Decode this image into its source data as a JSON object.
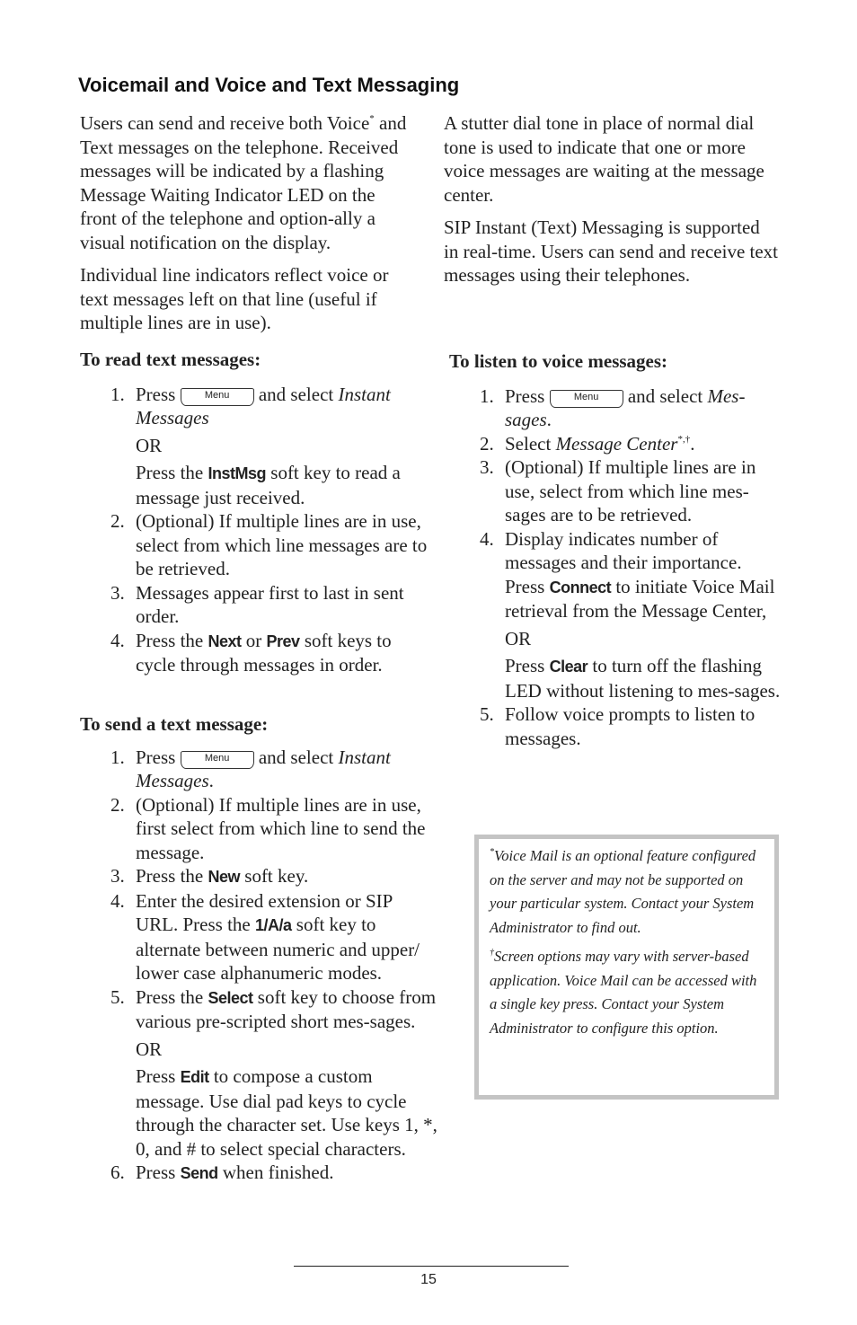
{
  "title": "Voicemail and Voice and Text Messaging",
  "intro_left": {
    "p1_a": "Users can send and receive both Voice",
    "p1_sup": "*",
    "p1_b": "and Text messages on the telephone. Received messages will be indicated by a flashing Message Waiting Indicator LED on the front of the telephone and option-ally a visual notification on the display.",
    "p2": "Individual line indicators reflect voice or text messages left on that line (useful if multiple lines are in use)."
  },
  "intro_right": {
    "p1": "A stutter dial tone in place of normal dial tone is used to indicate that one or more voice messages are waiting at the message center.",
    "p2": "SIP Instant (Text) Messaging is supported in real-time.  Users can send and receive text messages using their telephones."
  },
  "menu_key_label": "Menu",
  "read": {
    "heading": "To read text messages:",
    "s1_num": "1.",
    "s1_a": "Press",
    "s1_b": "and select",
    "s1_c": "Instant Messages",
    "or": "OR",
    "s1_d": "Press the",
    "s1_key": "InstMsg",
    "s1_e": "soft key to read a message just received.",
    "s2_num": "2.",
    "s2": "(Optional)  If multiple lines are in use, select from which line messages are to be retrieved.",
    "s3_num": "3.",
    "s3": "Messages appear first to last in sent order.",
    "s4_num": "4.",
    "s4_a": "Press the",
    "s4_k1": "Next",
    "s4_b": "or",
    "s4_k2": "Prev",
    "s4_c": "soft keys to cycle through messages in order."
  },
  "send": {
    "heading": "To send a text message:",
    "s1_num": "1.",
    "s1_a": "Press",
    "s1_b": "and select",
    "s1_c": "Instant Messages",
    "s1_d": ".",
    "s2_num": "2.",
    "s2": "(Optional)  If multiple lines are in use, first select from which line to send the message.",
    "s3_num": "3.",
    "s3_a": "Press the",
    "s3_key": "New",
    "s3_b": "soft key.",
    "s4_num": "4.",
    "s4_a": "Enter the desired extension or SIP URL.  Press the",
    "s4_key": "1/A/a",
    "s4_b": "soft key to alternate between numeric and upper/ lower case alphanumeric modes.",
    "s5_num": "5.",
    "s5_a": "Press the",
    "s5_key": "Select",
    "s5_b": "soft key to choose from various pre-scripted short mes-sages.",
    "or": "OR",
    "s5_c": "Press",
    "s5_key2": "Edit",
    "s5_d": "to compose a custom message.  Use dial pad keys to cycle through the character set.  Use keys 1, *, 0, and # to select special characters.",
    "s6_num": "6.",
    "s6_a": "Press",
    "s6_key": "Send",
    "s6_b": "when finished."
  },
  "listen": {
    "heading": "To listen to voice messages:",
    "s1_num": "1.",
    "s1_a": "Press",
    "s1_b": "and select",
    "s1_c": "Mes-sages",
    "s1_d": ".",
    "s2_num": "2.",
    "s2_a": "Select",
    "s2_b": "Message Center",
    "s2_sup": "*,†",
    "s2_c": ".",
    "s3_num": "3.",
    "s3": "(Optional)  If multiple lines are in use, select from which line mes-sages are to be retrieved.",
    "s4_num": "4.",
    "s4_a": "Display indicates number of messages and their importance. Press",
    "s4_key": "Connect",
    "s4_b": "to initiate Voice Mail retrieval from the Message Center,",
    "or": "OR",
    "s4_c": "Press",
    "s4_key2": "Clear",
    "s4_d": "to turn off the flashing LED without listening to mes-sages.",
    "s5_num": "5.",
    "s5": "Follow voice prompts to listen to messages."
  },
  "notes": {
    "n1_sup": "*",
    "n1": "Voice Mail is an optional feature configured on the server and may not be supported on your particular system. Contact your System Administrator to find out.",
    "n2_sup": "†",
    "n2": "Screen options may vary with server-based application.  Voice Mail can be accessed with a single key press.  Contact your System Administrator to configure this option."
  },
  "page_number": "15"
}
